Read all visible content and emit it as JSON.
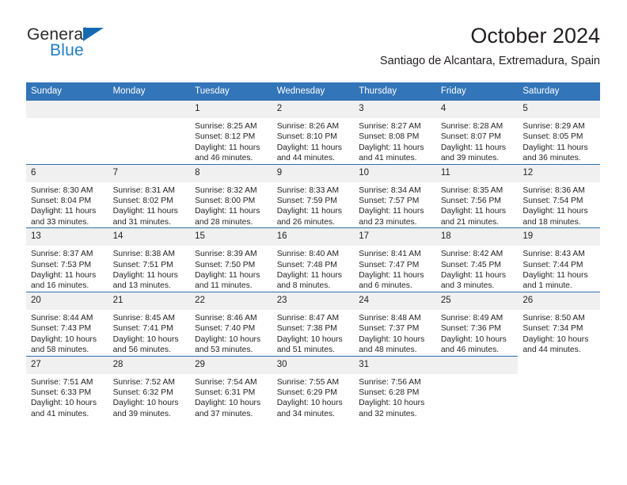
{
  "brand": {
    "name_part1": "General",
    "name_part2": "Blue",
    "accent_color": "#1f7ec4",
    "triangle_color": "#156bb1"
  },
  "header": {
    "title": "October 2024",
    "subtitle": "Santiago de Alcantara, Extremadura, Spain",
    "header_bg": "#3275b8",
    "daynum_bg": "#f0f0f0",
    "grid_line_color": "#2f6fad"
  },
  "weekdays": [
    "Sunday",
    "Monday",
    "Tuesday",
    "Wednesday",
    "Thursday",
    "Friday",
    "Saturday"
  ],
  "labels": {
    "sunrise_prefix": "Sunrise:",
    "sunset_prefix": "Sunset:",
    "daylight_prefix": "Daylight:"
  },
  "weeks": [
    [
      {
        "day": "",
        "sunrise": "",
        "sunset": "",
        "daylight": "",
        "empty": true
      },
      {
        "day": "",
        "sunrise": "",
        "sunset": "",
        "daylight": "",
        "empty": true
      },
      {
        "day": "1",
        "sunrise": "Sunrise: 8:25 AM",
        "sunset": "Sunset: 8:12 PM",
        "daylight": "Daylight: 11 hours and 46 minutes."
      },
      {
        "day": "2",
        "sunrise": "Sunrise: 8:26 AM",
        "sunset": "Sunset: 8:10 PM",
        "daylight": "Daylight: 11 hours and 44 minutes."
      },
      {
        "day": "3",
        "sunrise": "Sunrise: 8:27 AM",
        "sunset": "Sunset: 8:08 PM",
        "daylight": "Daylight: 11 hours and 41 minutes."
      },
      {
        "day": "4",
        "sunrise": "Sunrise: 8:28 AM",
        "sunset": "Sunset: 8:07 PM",
        "daylight": "Daylight: 11 hours and 39 minutes."
      },
      {
        "day": "5",
        "sunrise": "Sunrise: 8:29 AM",
        "sunset": "Sunset: 8:05 PM",
        "daylight": "Daylight: 11 hours and 36 minutes."
      }
    ],
    [
      {
        "day": "6",
        "sunrise": "Sunrise: 8:30 AM",
        "sunset": "Sunset: 8:04 PM",
        "daylight": "Daylight: 11 hours and 33 minutes."
      },
      {
        "day": "7",
        "sunrise": "Sunrise: 8:31 AM",
        "sunset": "Sunset: 8:02 PM",
        "daylight": "Daylight: 11 hours and 31 minutes."
      },
      {
        "day": "8",
        "sunrise": "Sunrise: 8:32 AM",
        "sunset": "Sunset: 8:00 PM",
        "daylight": "Daylight: 11 hours and 28 minutes."
      },
      {
        "day": "9",
        "sunrise": "Sunrise: 8:33 AM",
        "sunset": "Sunset: 7:59 PM",
        "daylight": "Daylight: 11 hours and 26 minutes."
      },
      {
        "day": "10",
        "sunrise": "Sunrise: 8:34 AM",
        "sunset": "Sunset: 7:57 PM",
        "daylight": "Daylight: 11 hours and 23 minutes."
      },
      {
        "day": "11",
        "sunrise": "Sunrise: 8:35 AM",
        "sunset": "Sunset: 7:56 PM",
        "daylight": "Daylight: 11 hours and 21 minutes."
      },
      {
        "day": "12",
        "sunrise": "Sunrise: 8:36 AM",
        "sunset": "Sunset: 7:54 PM",
        "daylight": "Daylight: 11 hours and 18 minutes."
      }
    ],
    [
      {
        "day": "13",
        "sunrise": "Sunrise: 8:37 AM",
        "sunset": "Sunset: 7:53 PM",
        "daylight": "Daylight: 11 hours and 16 minutes."
      },
      {
        "day": "14",
        "sunrise": "Sunrise: 8:38 AM",
        "sunset": "Sunset: 7:51 PM",
        "daylight": "Daylight: 11 hours and 13 minutes."
      },
      {
        "day": "15",
        "sunrise": "Sunrise: 8:39 AM",
        "sunset": "Sunset: 7:50 PM",
        "daylight": "Daylight: 11 hours and 11 minutes."
      },
      {
        "day": "16",
        "sunrise": "Sunrise: 8:40 AM",
        "sunset": "Sunset: 7:48 PM",
        "daylight": "Daylight: 11 hours and 8 minutes."
      },
      {
        "day": "17",
        "sunrise": "Sunrise: 8:41 AM",
        "sunset": "Sunset: 7:47 PM",
        "daylight": "Daylight: 11 hours and 6 minutes."
      },
      {
        "day": "18",
        "sunrise": "Sunrise: 8:42 AM",
        "sunset": "Sunset: 7:45 PM",
        "daylight": "Daylight: 11 hours and 3 minutes."
      },
      {
        "day": "19",
        "sunrise": "Sunrise: 8:43 AM",
        "sunset": "Sunset: 7:44 PM",
        "daylight": "Daylight: 11 hours and 1 minute."
      }
    ],
    [
      {
        "day": "20",
        "sunrise": "Sunrise: 8:44 AM",
        "sunset": "Sunset: 7:43 PM",
        "daylight": "Daylight: 10 hours and 58 minutes."
      },
      {
        "day": "21",
        "sunrise": "Sunrise: 8:45 AM",
        "sunset": "Sunset: 7:41 PM",
        "daylight": "Daylight: 10 hours and 56 minutes."
      },
      {
        "day": "22",
        "sunrise": "Sunrise: 8:46 AM",
        "sunset": "Sunset: 7:40 PM",
        "daylight": "Daylight: 10 hours and 53 minutes."
      },
      {
        "day": "23",
        "sunrise": "Sunrise: 8:47 AM",
        "sunset": "Sunset: 7:38 PM",
        "daylight": "Daylight: 10 hours and 51 minutes."
      },
      {
        "day": "24",
        "sunrise": "Sunrise: 8:48 AM",
        "sunset": "Sunset: 7:37 PM",
        "daylight": "Daylight: 10 hours and 48 minutes."
      },
      {
        "day": "25",
        "sunrise": "Sunrise: 8:49 AM",
        "sunset": "Sunset: 7:36 PM",
        "daylight": "Daylight: 10 hours and 46 minutes."
      },
      {
        "day": "26",
        "sunrise": "Sunrise: 8:50 AM",
        "sunset": "Sunset: 7:34 PM",
        "daylight": "Daylight: 10 hours and 44 minutes."
      }
    ],
    [
      {
        "day": "27",
        "sunrise": "Sunrise: 7:51 AM",
        "sunset": "Sunset: 6:33 PM",
        "daylight": "Daylight: 10 hours and 41 minutes."
      },
      {
        "day": "28",
        "sunrise": "Sunrise: 7:52 AM",
        "sunset": "Sunset: 6:32 PM",
        "daylight": "Daylight: 10 hours and 39 minutes."
      },
      {
        "day": "29",
        "sunrise": "Sunrise: 7:54 AM",
        "sunset": "Sunset: 6:31 PM",
        "daylight": "Daylight: 10 hours and 37 minutes."
      },
      {
        "day": "30",
        "sunrise": "Sunrise: 7:55 AM",
        "sunset": "Sunset: 6:29 PM",
        "daylight": "Daylight: 10 hours and 34 minutes."
      },
      {
        "day": "31",
        "sunrise": "Sunrise: 7:56 AM",
        "sunset": "Sunset: 6:28 PM",
        "daylight": "Daylight: 10 hours and 32 minutes."
      },
      {
        "day": "",
        "sunrise": "",
        "sunset": "",
        "daylight": "",
        "empty": true
      },
      {
        "day": "",
        "sunrise": "",
        "sunset": "",
        "daylight": "",
        "empty": true,
        "nocell": true
      }
    ]
  ]
}
